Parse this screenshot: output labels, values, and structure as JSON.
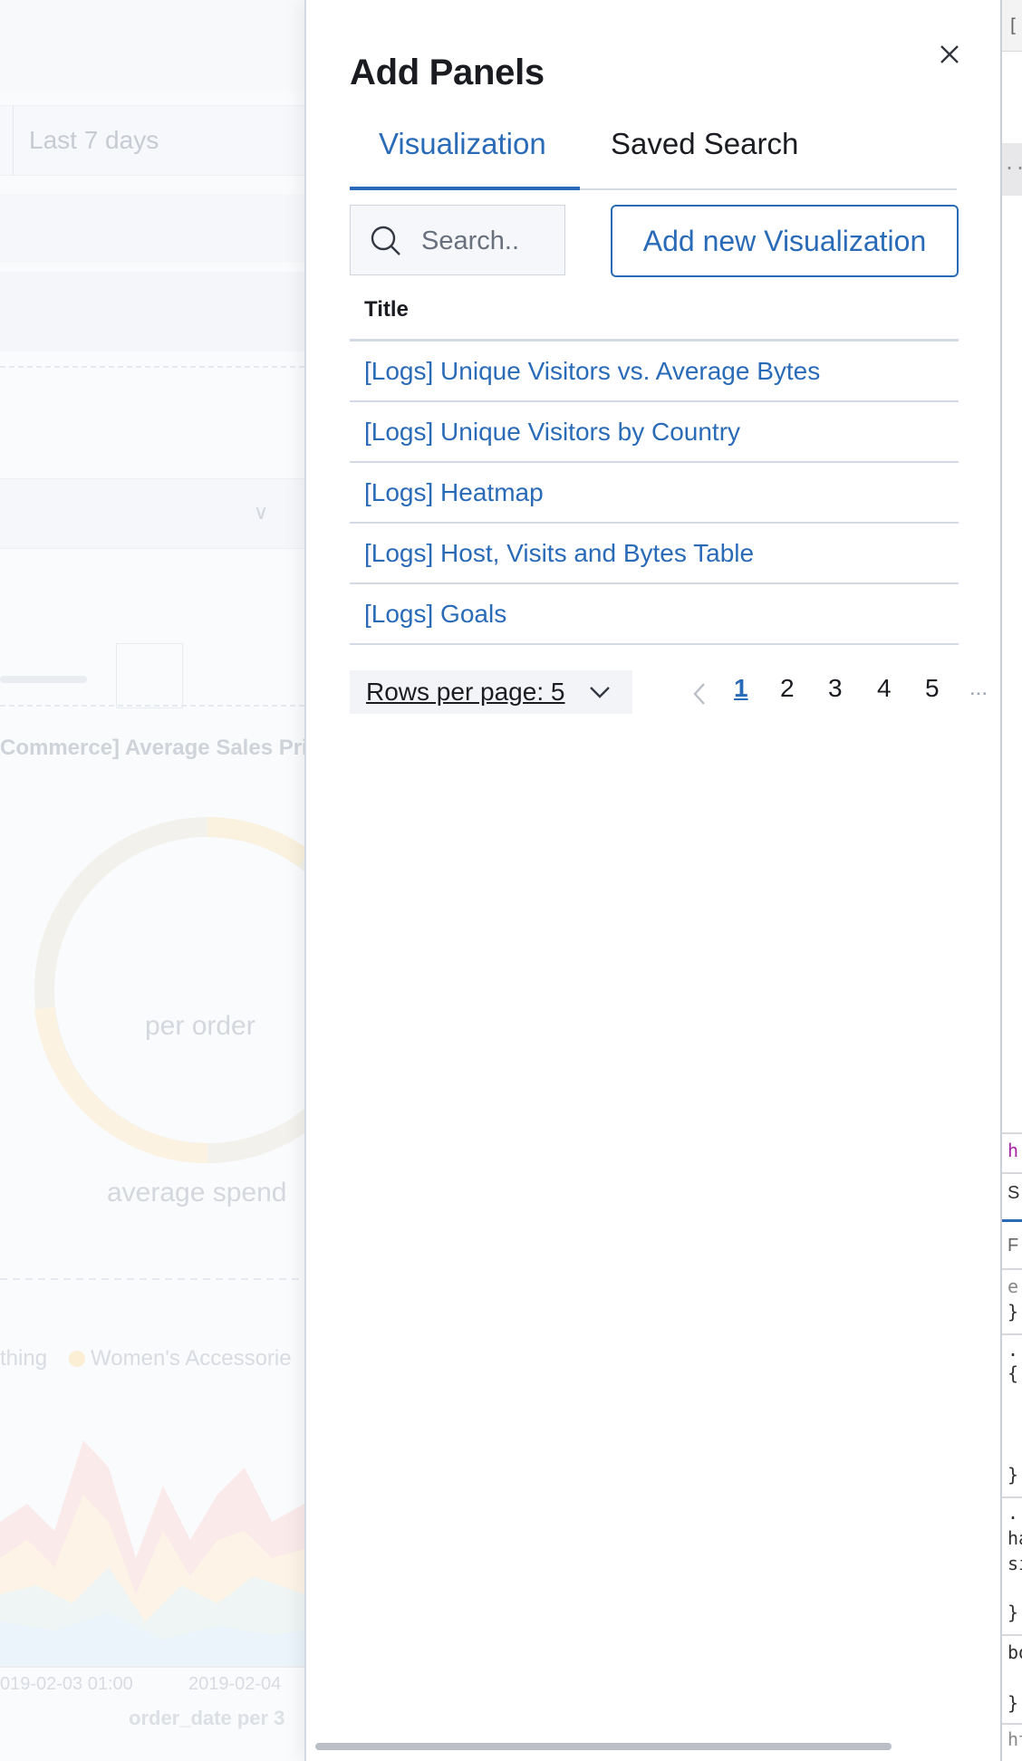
{
  "background": {
    "time_picker_text": "Last 7 days",
    "panel_title": "Commerce] Average Sales Pri",
    "donut_center_text": "per order",
    "donut_caption": "average spend",
    "legend_partial": "thing",
    "legend_item": "Women's Accessorie",
    "x_ticks": [
      "019-02-03 01:00",
      "2019-02-04"
    ],
    "x_axis_label": "order_date per 3"
  },
  "flyout": {
    "title": "Add Panels",
    "close_icon": "close-icon",
    "tabs": [
      {
        "label": "Visualization",
        "active": true
      },
      {
        "label": "Saved Search",
        "active": false
      }
    ],
    "search": {
      "placeholder": "Search..",
      "value": ""
    },
    "add_button_label": "Add new Visualization",
    "table": {
      "column_title": "Title",
      "rows": [
        {
          "title": "[Logs] Unique Visitors vs. Average Bytes"
        },
        {
          "title": "[Logs] Unique Visitors by Country"
        },
        {
          "title": "[Logs] Heatmap"
        },
        {
          "title": "[Logs] Host, Visits and Bytes Table"
        },
        {
          "title": "[Logs] Goals"
        }
      ]
    },
    "pagination": {
      "rows_per_page_label": "Rows per page: 5",
      "pages": [
        "1",
        "2",
        "3",
        "4",
        "5"
      ],
      "current_page": "1",
      "ellipsis": "..."
    }
  },
  "devtools_fragments": {
    "frag_top": "[",
    "frag_dots": "...",
    "frag_h": "h",
    "frag_s": "S",
    "frag_f": "F",
    "frag_e": "e",
    "frag_brace_close": "}",
    "frag_dot": ".",
    "frag_brace_open": "{",
    "frag_ha": "ha",
    "frag_si": "si",
    "frag_bo": "bo",
    "frag_ht": "ht"
  },
  "colors": {
    "accent": "#2a6bb8",
    "text": "#1a1c21",
    "border": "#d3dae6"
  }
}
